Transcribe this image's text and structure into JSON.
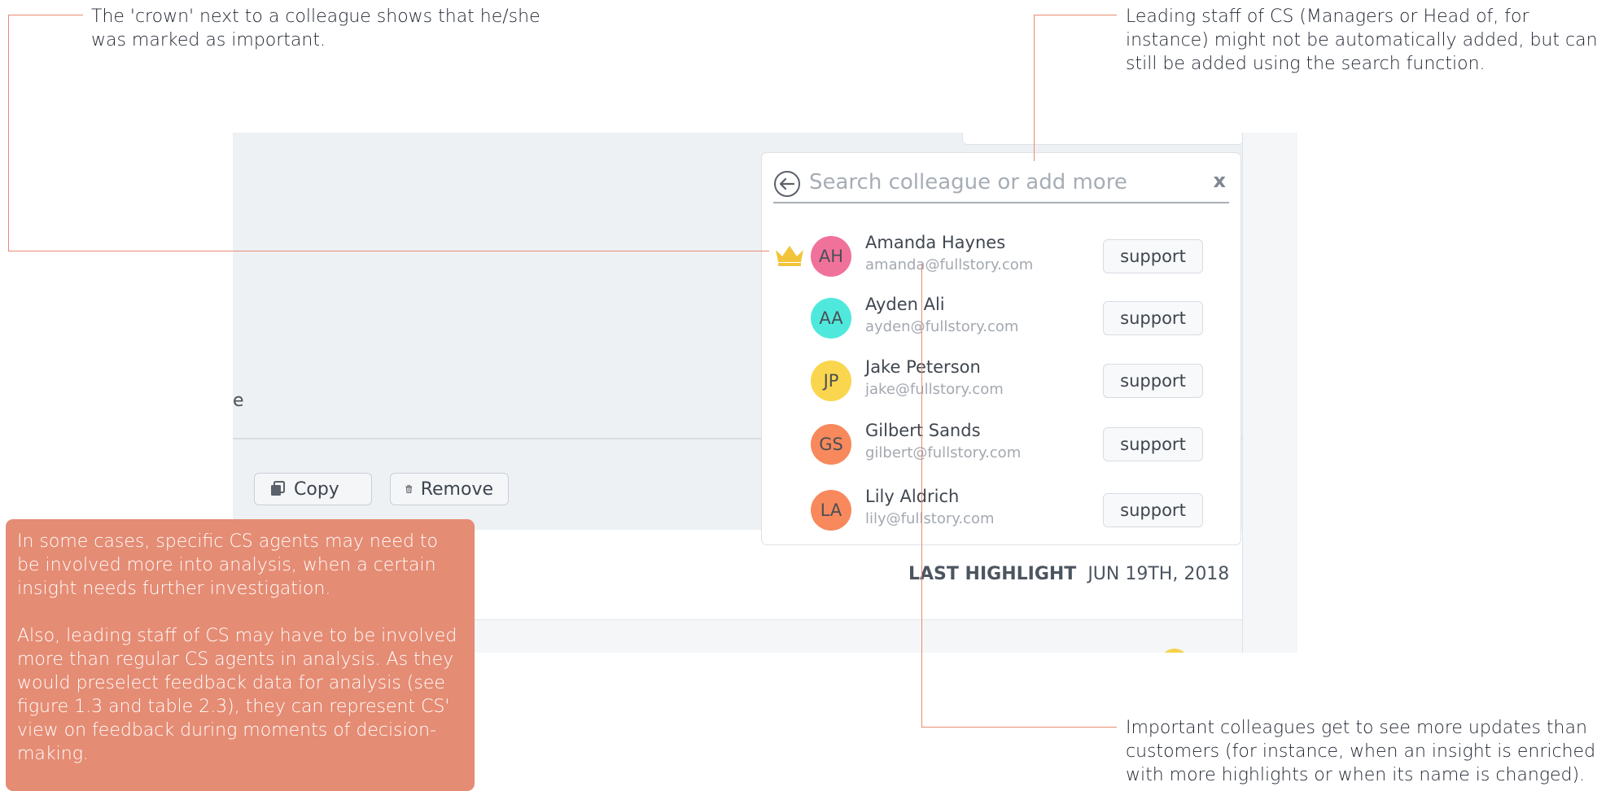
{
  "annotations": {
    "crown_note": "The 'crown' next to a colleague shows that he/she was marked as important.",
    "leading_staff_note": "Leading staff of CS (Managers or Head of, for instance) might not be automatically added, but can still be added using the search function.",
    "updates_note": "Important colleagues get to see more updates than customers (for instance, when an insight is enriched with more highlights or when its name is changed).",
    "callout_paragraphs": [
      "In some cases, specific CS agents may need to be involved more into analysis, when a certain insight needs further investigation.",
      "Also, leading staff of CS may have to be involved more than regular CS agents in analysis. As they would preselect feedback data for analysis (see figure 1.3 and table 2.3), they can represent CS' view on feedback during moments of decision-making."
    ]
  },
  "app": {
    "partial_text": "e",
    "copy_button": "Copy",
    "remove_button": "Remove",
    "last_highlight_label": "LAST HIGHLIGHT",
    "last_highlight_date": "JUN 19TH, 2018"
  },
  "search": {
    "placeholder": "Search colleague or add more",
    "close_label": "x"
  },
  "colleagues": [
    {
      "initials": "AH",
      "name": "Amanda Haynes",
      "email": "amanda@fullstory.com",
      "tag": "support",
      "important": true,
      "color": "#f0729a"
    },
    {
      "initials": "AA",
      "name": "Ayden Ali",
      "email": "ayden@fullstory.com",
      "tag": "support",
      "important": false,
      "color": "#4ee9dc"
    },
    {
      "initials": "JP",
      "name": "Jake Peterson",
      "email": "jake@fullstory.com",
      "tag": "support",
      "important": false,
      "color": "#f9d64e"
    },
    {
      "initials": "GS",
      "name": "Gilbert Sands",
      "email": "gilbert@fullstory.com",
      "tag": "support",
      "important": false,
      "color": "#f7895c"
    },
    {
      "initials": "LA",
      "name": "Lily Aldrich",
      "email": "lily@fullstory.com",
      "tag": "support",
      "important": false,
      "color": "#f7895c"
    }
  ],
  "colors": {
    "accent_line": "#e78a73",
    "callout_bg": "#e58c74",
    "crown": "#f2c43a"
  }
}
